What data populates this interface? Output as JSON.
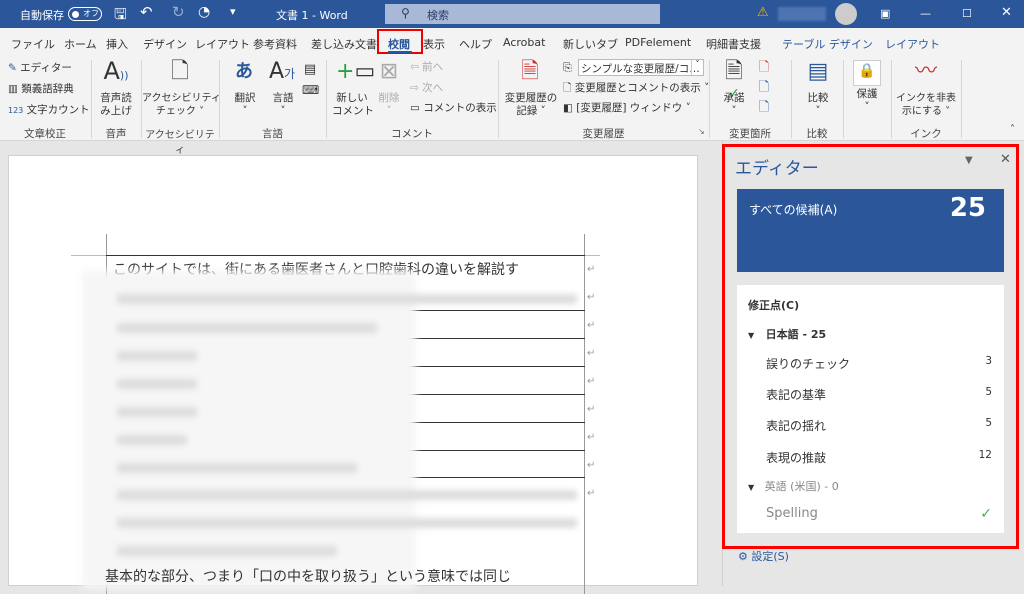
{
  "titlebar": {
    "autosave_label": "自動保存",
    "autosave_state": "オフ",
    "doc_title": "文書 1  -  Word",
    "search_placeholder": "検索"
  },
  "tabs": [
    "ファイル",
    "ホーム",
    "挿入",
    "デザイン",
    "レイアウト",
    "参考資料",
    "差し込み文書",
    "校閲",
    "表示",
    "ヘルプ",
    "Acrobat",
    "新しいタブ",
    "PDFelement",
    "明細書支援",
    "テーブル デザイン",
    "レイアウト"
  ],
  "selected_tab": "校閲",
  "ribbon": {
    "proofing": {
      "editor": "エディター",
      "thesaurus": "類義語辞典",
      "word_count": "文字カウント",
      "group": "文章校正"
    },
    "speech": {
      "read_aloud_1": "音声読",
      "read_aloud_2": "み上げ",
      "group": "音声"
    },
    "accessibility": {
      "check_1": "アクセシビリティ",
      "check_2": "チェック ˅",
      "group": "アクセシビリティ"
    },
    "language": {
      "translate": "翻訳",
      "language": "言語",
      "group": "言語"
    },
    "comments": {
      "new_1": "新しい",
      "new_2": "コメント",
      "delete": "削除",
      "prev": "前へ",
      "next": "次へ",
      "show": "コメントの表示",
      "group": "コメント"
    },
    "tracking": {
      "track_1": "変更履歴の",
      "track_2": "記録 ˅",
      "markup_select": "シンプルな変更履歴/コ…",
      "show_markup": "変更履歴とコメントの表示 ˅",
      "pane": "[変更履歴] ウィンドウ ˅",
      "group": "変更履歴"
    },
    "changes": {
      "accept": "承諾",
      "group": "変更箇所"
    },
    "compare": {
      "compare": "比較",
      "group": "比較"
    },
    "protect": {
      "protect": "保護"
    },
    "ink": {
      "hide_1": "インクを非表",
      "hide_2": "示にする ˅",
      "group": "インク"
    }
  },
  "document": {
    "first_line": "このサイトでは、街にある歯医者さんと口腔歯科の違いを解説す",
    "last_line": "基本的な部分、つまり「口の中を取り扱う」という意味では同じ"
  },
  "editor_pane": {
    "title": "エディター",
    "all_suggestions_label": "すべての候補(A)",
    "all_suggestions_count": "25",
    "corrections_label": "修正点(C)",
    "japanese_header": "日本語 - 25",
    "items": [
      {
        "label": "誤りのチェック",
        "count": "3"
      },
      {
        "label": "表記の基準",
        "count": "5"
      },
      {
        "label": "表記の揺れ",
        "count": "5"
      },
      {
        "label": "表現の推敲",
        "count": "12"
      }
    ],
    "english_header": "英語 (米国) - 0",
    "spelling_label": "Spelling",
    "settings_label": "設定(S)"
  },
  "colors": {
    "brand": "#2b579a",
    "highlight": "#ff0000",
    "check": "#4caf50"
  }
}
